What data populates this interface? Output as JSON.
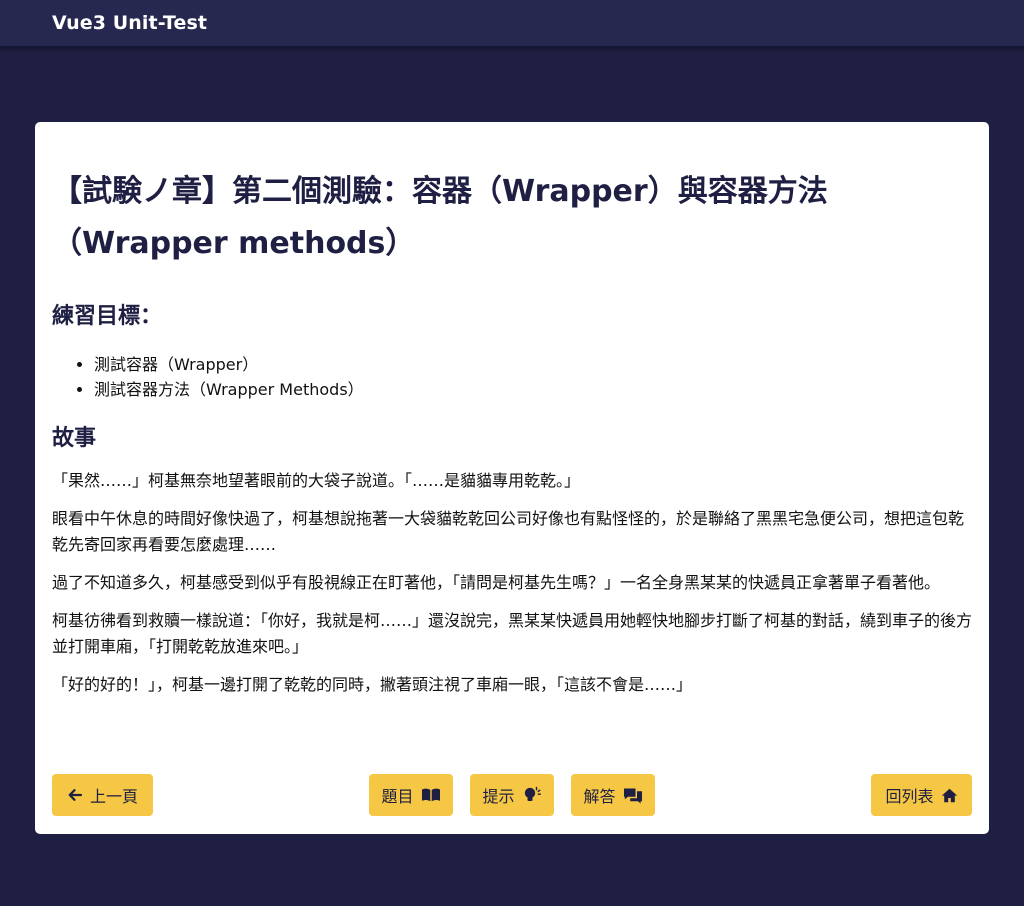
{
  "navbar": {
    "brand": "Vue3 Unit-Test"
  },
  "page": {
    "title_line1": "【試験ノ章】第二個測驗：容器（Wrapper）與容器方法",
    "title_line2": "（Wrapper methods）"
  },
  "goals": {
    "heading": "練習目標：",
    "items": [
      "測試容器（Wrapper）",
      "測試容器方法（Wrapper Methods）"
    ]
  },
  "story": {
    "heading": "故事",
    "paragraphs": [
      "「果然……」柯基無奈地望著眼前的大袋子說道。「……是貓貓專用乾乾。」",
      "眼看中午休息的時間好像快過了，柯基想說拖著一大袋貓乾乾回公司好像也有點怪怪的，於是聯絡了黑黑宅急便公司，想把這包乾乾先寄回家再看要怎麼處理……",
      "過了不知道多久，柯基感受到似乎有股視線正在盯著他，「請問是柯基先生嗎？」一名全身黑某某的快遞員正拿著單子看著他。",
      "柯基彷彿看到救贖一樣說道：「你好，我就是柯……」還沒說完，黑某某快遞員用她輕快地腳步打斷了柯基的對話，繞到車子的後方並打開車廂，「打開乾乾放進來吧。」",
      "「好的好的！」，柯基一邊打開了乾乾的同時，撇著頭注視了車廂一眼，「這該不會是……」"
    ]
  },
  "buttons": {
    "prev": "上一頁",
    "question": "題目",
    "hint": "提示",
    "answer": "解答",
    "back_to_list": "回列表"
  },
  "colors": {
    "background": "#1e1f42",
    "navbar": "#27284f",
    "button": "#f6c744",
    "text_dark": "#1e1f42"
  },
  "icons": {
    "prev": "arrow-left-icon",
    "question": "book-open-icon",
    "hint": "lightbulb-icon",
    "answer": "chat-bubbles-icon",
    "back_to_list": "home-icon"
  }
}
